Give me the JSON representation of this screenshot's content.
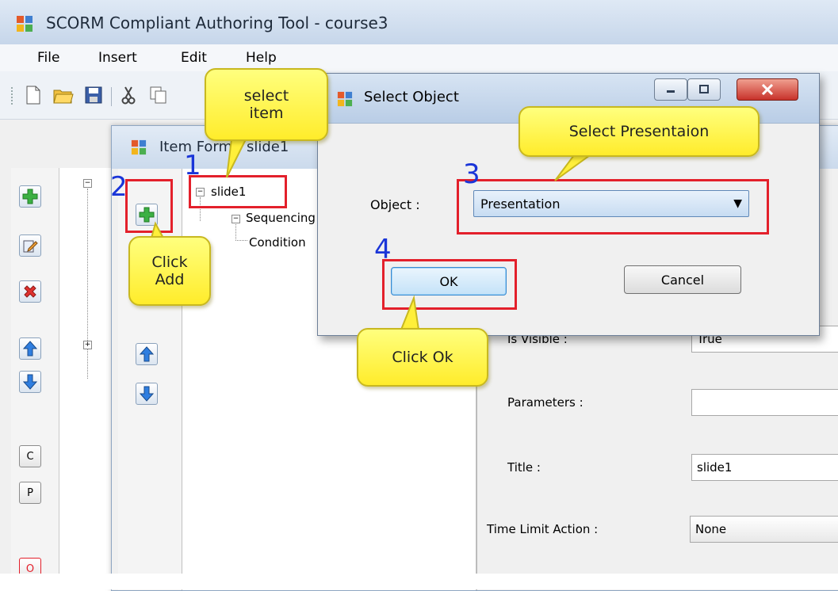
{
  "app": {
    "title": "SCORM Compliant Authoring Tool - course3",
    "menu": [
      "File",
      "Insert",
      "Edit",
      "Help"
    ]
  },
  "main_rail": {
    "letters": [
      "C",
      "P",
      "O"
    ]
  },
  "item_window": {
    "title": "Item Form - slide1",
    "tree": {
      "root": "slide1",
      "child": "Sequencing",
      "grandchild": "Condition"
    }
  },
  "properties": {
    "is_visible_label": "Is Visible :",
    "is_visible_value": "True",
    "parameters_label": "Parameters :",
    "parameters_value": "",
    "title_label": "Title :",
    "title_value": "slide1",
    "time_limit_label": "Time Limit Action :",
    "time_limit_value": "None"
  },
  "dialog": {
    "title": "Select Object",
    "object_label": "Object :",
    "object_value": "Presentation",
    "ok_label": "OK",
    "cancel_label": "Cancel"
  },
  "annotations": {
    "step1": "1",
    "step2": "2",
    "step3": "3",
    "step4": "4",
    "callout_select_item": "select item",
    "callout_click_add": "Click Add",
    "callout_select_presentation": "Select Presentaion",
    "callout_click_ok": "Click Ok"
  },
  "colors": {
    "annotation_red": "#e3202b",
    "step_blue": "#1a35d8",
    "callout_yellow": "#ffff7e"
  }
}
